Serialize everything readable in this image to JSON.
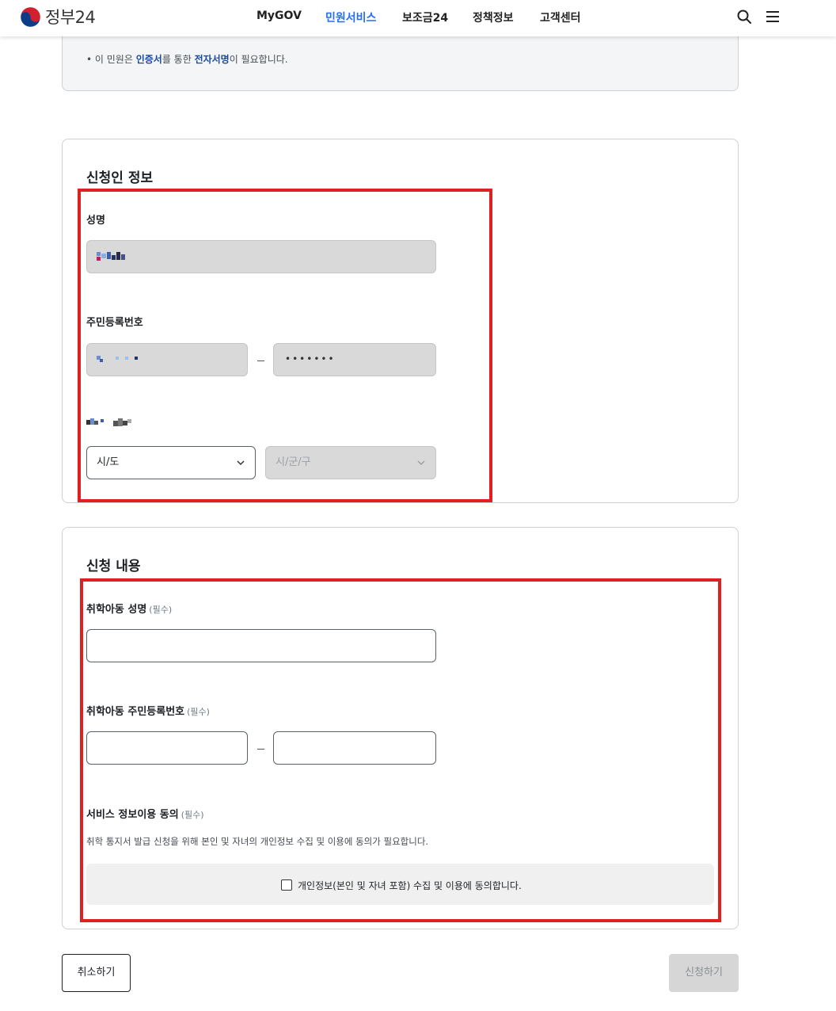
{
  "header": {
    "logo_text": "정부24",
    "nav": [
      "MyGOV",
      "민원서비스",
      "보조금24",
      "정책정보",
      "고객센터"
    ],
    "active_nav_index": 1,
    "accent_color": "#256ef4",
    "icons": [
      "search-icon",
      "menu-icon"
    ]
  },
  "notice": {
    "prefix": "• 이 민원은 ",
    "cert": "인증서",
    "middle": "를 통한 ",
    "sign": "전자서명",
    "suffix": "이 필요합니다."
  },
  "applicant": {
    "title": "신청인 정보",
    "name_label": "성명",
    "rrn_label": "주민등록번호",
    "rrn_back_masked": "•••••••",
    "sido_placeholder": "시/도",
    "sigungu_placeholder": "시/군/구"
  },
  "request": {
    "title": "신청 내용",
    "child_name_label": "취학아동 성명",
    "child_rrn_label": "취학아동 주민등록번호",
    "consent_label": "서비스 정보이용 동의",
    "required": "(필수)",
    "consent_help": "취학 통지서 발급 신청을 위해 본인 및 자녀의 개인정보 수집 및 이용에 동의가 필요합니다.",
    "consent_checkbox_label": "개인정보(본인 및 자녀 포함) 수집 및 이용에 동의합니다."
  },
  "buttons": {
    "cancel": "취소하기",
    "submit": "신청하기"
  },
  "highlight_color": "#e02020"
}
